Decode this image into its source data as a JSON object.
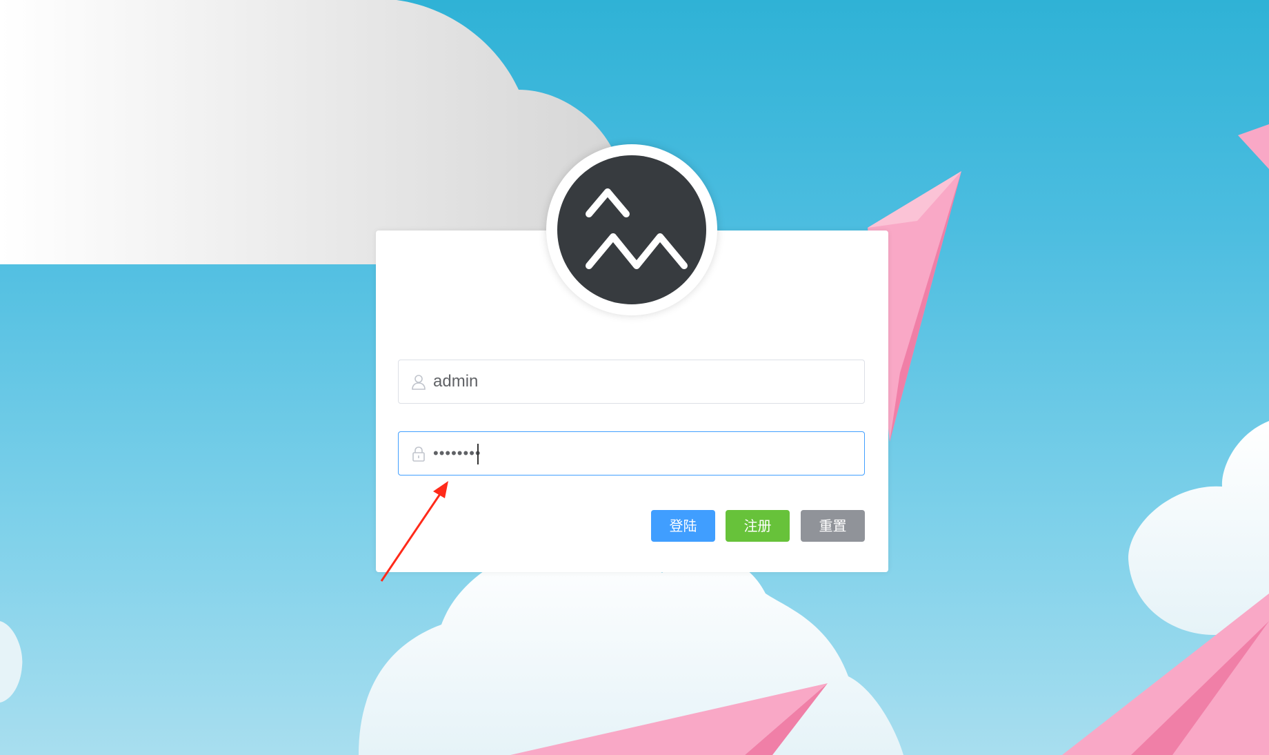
{
  "logo": {
    "icon": "mountain-logo-icon"
  },
  "username": {
    "value": "admin",
    "icon": "user-icon"
  },
  "password": {
    "value": "••••••••",
    "icon": "lock-icon"
  },
  "buttons": {
    "login": "登陆",
    "register": "注册",
    "reset": "重置"
  },
  "colors": {
    "primary": "#409eff",
    "success": "#67c23a",
    "info": "#909399",
    "avatar_bg": "#373b3f",
    "annotation_arrow": "#ff2a1a"
  }
}
